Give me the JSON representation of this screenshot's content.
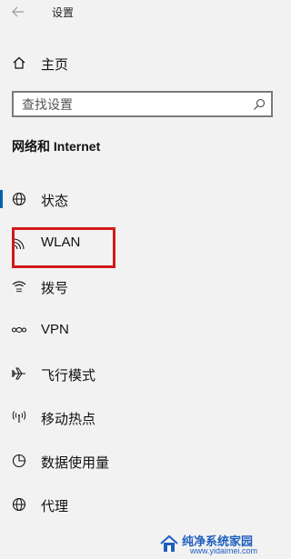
{
  "window": {
    "title": "设置",
    "back_icon": "arrow-left-icon"
  },
  "home": {
    "label": "主页",
    "icon": "home-icon"
  },
  "search": {
    "placeholder": "查找设置",
    "icon": "search-icon"
  },
  "section": {
    "title": "网络和 Internet"
  },
  "nav": {
    "items": [
      {
        "label": "状态",
        "icon": "globe-icon",
        "active": true
      },
      {
        "label": "WLAN",
        "icon": "wifi-icon",
        "highlighted": true
      },
      {
        "label": "拨号",
        "icon": "dialup-icon"
      },
      {
        "label": "VPN",
        "icon": "vpn-icon"
      },
      {
        "label": "飞行模式",
        "icon": "airplane-icon"
      },
      {
        "label": "移动热点",
        "icon": "hotspot-icon"
      },
      {
        "label": "数据使用量",
        "icon": "data-usage-icon"
      },
      {
        "label": "代理",
        "icon": "globe-icon"
      }
    ]
  },
  "watermark": {
    "title": "纯净系统家园",
    "url": "www.yidaimei.com"
  },
  "colors": {
    "background": "#f2f2f2",
    "accent": "#0063b1",
    "highlight": "#d11a1a",
    "watermark": "#1f5fbf"
  }
}
